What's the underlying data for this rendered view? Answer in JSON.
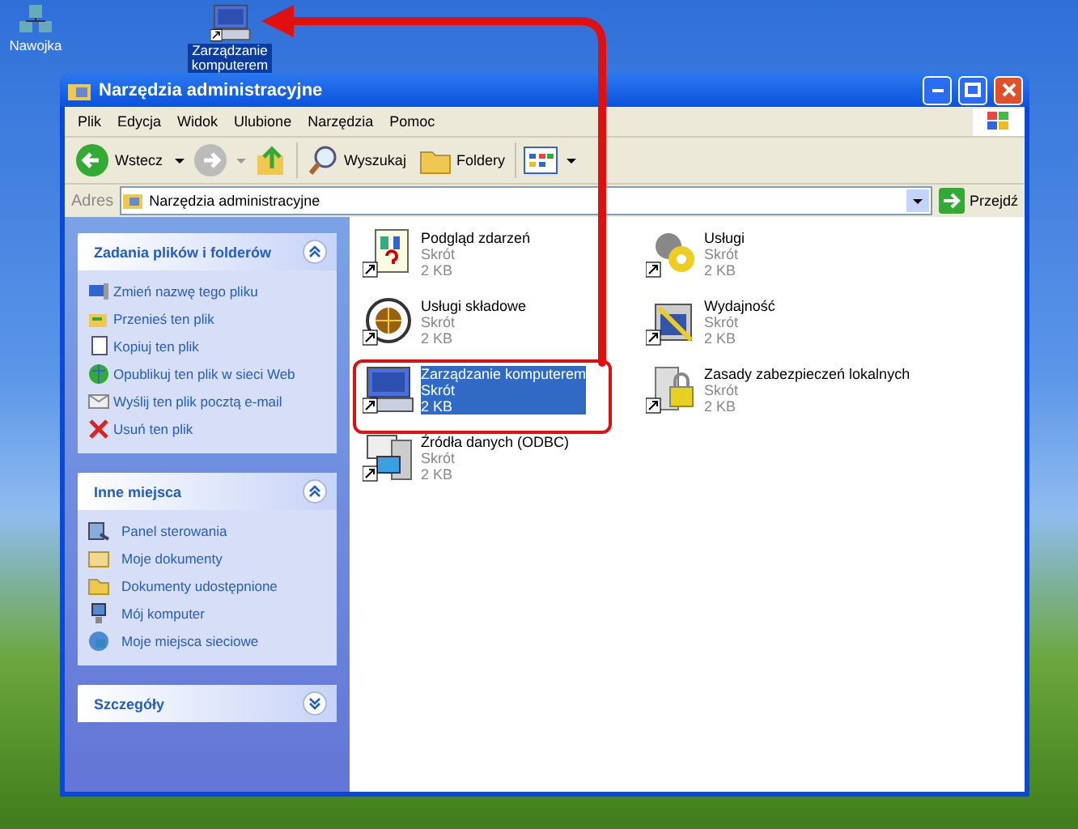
{
  "desktop_icons": [
    {
      "label": "Nawojka",
      "selected": false
    },
    {
      "label": "Zarządzanie komputerem",
      "selected": true
    }
  ],
  "window": {
    "title": "Narzędzia administracyjne"
  },
  "menu": [
    "Plik",
    "Edycja",
    "Widok",
    "Ulubione",
    "Narzędzia",
    "Pomoc"
  ],
  "toolbar": {
    "back": "Wstecz",
    "search": "Wyszukaj",
    "folders": "Foldery"
  },
  "address_bar": {
    "label": "Adres",
    "value": "Narzędzia administracyjne",
    "go": "Przejdź"
  },
  "task_panels": [
    {
      "title": "Zadania plików i folderów",
      "expanded": true,
      "items": [
        "Zmień nazwę tego pliku",
        "Przenieś ten plik",
        "Kopiuj ten plik",
        "Opublikuj ten plik w sieci Web",
        "Wyślij ten plik pocztą e-mail",
        "Usuń ten plik"
      ]
    },
    {
      "title": "Inne miejsca",
      "expanded": true,
      "items": [
        "Panel sterowania",
        "Moje dokumenty",
        "Dokumenty udostępnione",
        "Mój komputer",
        "Moje miejsca sieciowe"
      ]
    },
    {
      "title": "Szczegóły",
      "expanded": false
    }
  ],
  "files": [
    {
      "name": "Podgląd zdarzeń",
      "type": "Skrót",
      "size": "2 KB",
      "selected": false
    },
    {
      "name": "Usługi",
      "type": "Skrót",
      "size": "2 KB",
      "selected": false
    },
    {
      "name": "Usługi składowe",
      "type": "Skrót",
      "size": "2 KB",
      "selected": false
    },
    {
      "name": "Wydajność",
      "type": "Skrót",
      "size": "2 KB",
      "selected": false
    },
    {
      "name": "Zarządzanie komputerem",
      "type": "Skrót",
      "size": "2 KB",
      "selected": true
    },
    {
      "name": "Zasady zabezpieczeń lokalnych",
      "type": "Skrót",
      "size": "2 KB",
      "selected": false
    },
    {
      "name": "Źródła danych (ODBC)",
      "type": "Skrót",
      "size": "2 KB",
      "selected": false
    }
  ]
}
